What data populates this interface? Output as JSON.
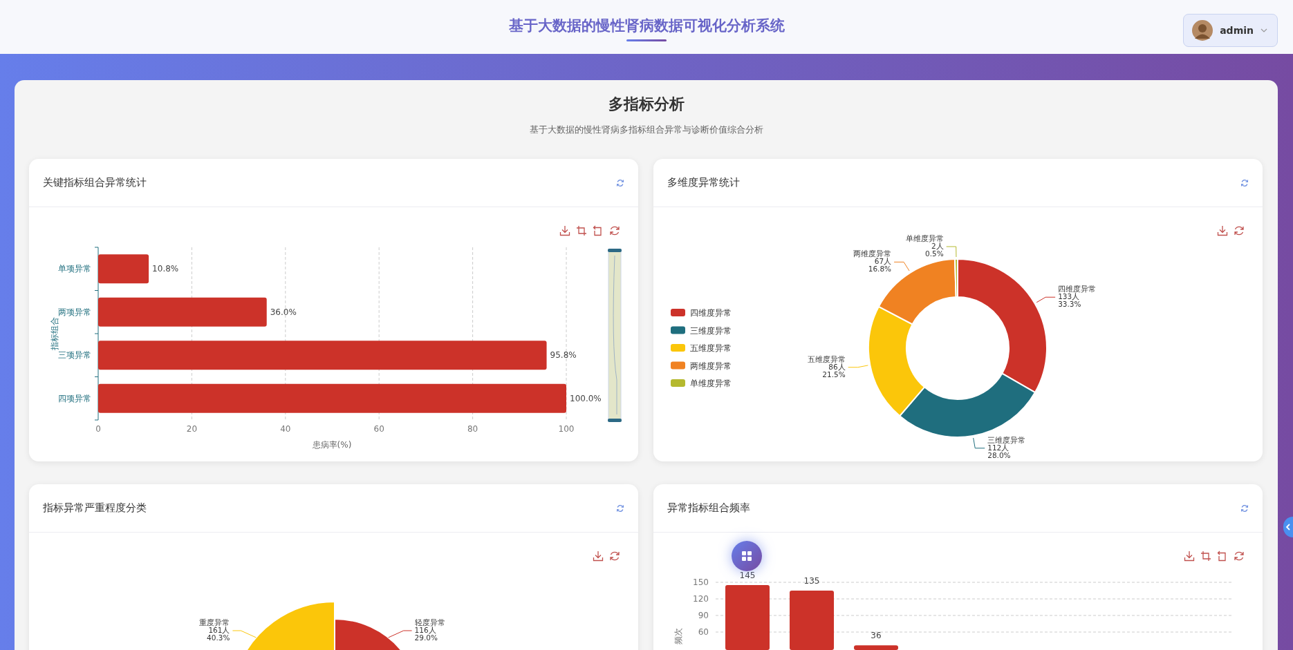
{
  "header": {
    "title": "基于大数据的慢性肾病数据可视化分析系统",
    "user": {
      "name": "admin"
    }
  },
  "page": {
    "title": "多指标分析",
    "subtitle": "基于大数据的慢性肾病多指标组合异常与诊断价值综合分析"
  },
  "cards": [
    {
      "title": "关键指标组合异常统计",
      "toolbox": [
        {
          "kind": "download"
        },
        {
          "kind": "zoom"
        },
        {
          "kind": "zoom_back"
        },
        {
          "kind": "restore"
        }
      ],
      "data_zoom": true,
      "chart_data": {
        "type": "bar",
        "orientation": "horizontal",
        "grid": true,
        "xlabel": "患病率(%)",
        "ylabel": "指标组合",
        "categories": [
          "单项异常",
          "两项异常",
          "三项异常",
          "四项异常"
        ],
        "series": [
          {
            "color": "#cc3229",
            "values": [
              10.8,
              36.0,
              95.8,
              100.0
            ]
          }
        ],
        "xlim": [
          0,
          100
        ],
        "xticks": [
          0,
          20,
          40,
          60,
          80,
          100
        ],
        "value_labels": [
          "10.8%",
          "36.0%",
          "95.8%",
          "100.0%"
        ]
      }
    },
    {
      "title": "多维度异常统计",
      "toolbox": [
        {
          "kind": "download"
        },
        {
          "kind": "restore"
        }
      ],
      "chart_data": {
        "type": "donut",
        "legend": true,
        "categories": [
          "四维度异常",
          "三维度异常",
          "五维度异常",
          "两维度异常",
          "单维度异常"
        ],
        "series": [
          {
            "values": [
              33.3,
              28.0,
              21.5,
              16.8,
              0.5
            ],
            "colors": [
              "#cc3229",
              "#1f6e7e",
              "#fbc60a",
              "#f08222",
              "#b5b92e"
            ]
          }
        ],
        "value_labels": [
          [
            "133人",
            "33.3%"
          ],
          [
            "112人",
            "28.0%"
          ],
          [
            "86人",
            "21.5%"
          ],
          [
            "67人",
            "16.8%"
          ],
          [
            "2人",
            "0.5%"
          ]
        ]
      }
    },
    {
      "title": "指标异常严重程度分类",
      "toolbox": [
        {
          "kind": "download"
        },
        {
          "kind": "restore"
        }
      ],
      "slices": [
        {
          "label": "重度异常",
          "lines": [
            "161人",
            "40.3%"
          ],
          "color": "#fbc60a"
        },
        {
          "label": "轻度异常",
          "lines": [
            "116人",
            "29.0%"
          ],
          "color": "#cc3229"
        }
      ]
    },
    {
      "title": "异常指标组合频率",
      "toolbox": [
        {
          "kind": "download"
        },
        {
          "kind": "zoom"
        },
        {
          "kind": "zoom_back"
        },
        {
          "kind": "restore"
        }
      ],
      "chart_data": {
        "type": "bar",
        "orientation": "vertical",
        "grid": true,
        "ylim": [
          27.5,
          150
        ],
        "ylabel": "频次",
        "series": [
          {
            "color": "#cc3229",
            "values": [
              145,
              135,
              36
            ]
          }
        ],
        "yticks": [
          60,
          90,
          120,
          150
        ],
        "value_labels": [
          "145",
          "135",
          "36"
        ]
      }
    }
  ]
}
